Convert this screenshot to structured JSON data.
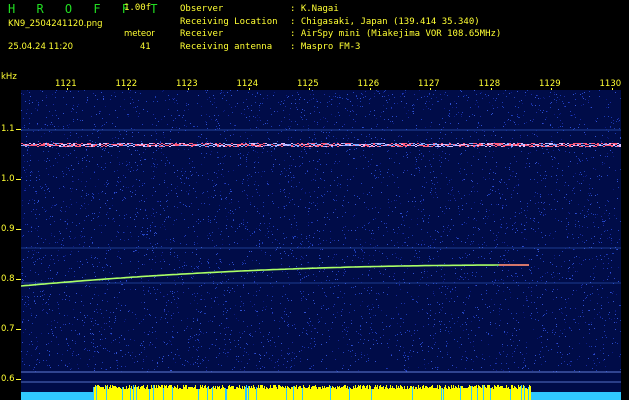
{
  "header": {
    "brand": "H R O F F T",
    "version": "1.00f",
    "filename": "KN9_2504241120.png",
    "datetime": "25.04.24 11:20",
    "meteor_label": "meteor",
    "meteor_count": "41",
    "metadata": [
      {
        "key": "Observer",
        "value": "K.Nagai"
      },
      {
        "key": "Receiving Location",
        "value": "Chigasaki, Japan (139.414 35.340)"
      },
      {
        "key": "Receiver",
        "value": "AirSpy mini (Miakejima VOR 108.65MHz)"
      },
      {
        "key": "Receiving antenna",
        "value": "Maspro FM-3"
      }
    ]
  },
  "axes": {
    "y_unit": "kHz",
    "y_ticks": [
      "1.1",
      "1.0",
      "0.9",
      "0.8",
      "0.7",
      "0.6"
    ],
    "x_ticks": [
      "1121",
      "1122",
      "1123",
      "1124",
      "1125",
      "1126",
      "1127",
      "1128",
      "1129",
      "1130"
    ]
  },
  "colors": {
    "background": "#000000",
    "text": "#ffff33",
    "brand": "#22dd22",
    "plot_bg": "#000c48",
    "carrier": "#ff5a7a",
    "meteor": "#aaff66",
    "power": "#ffff00",
    "power_base": "#30c8ff"
  }
}
